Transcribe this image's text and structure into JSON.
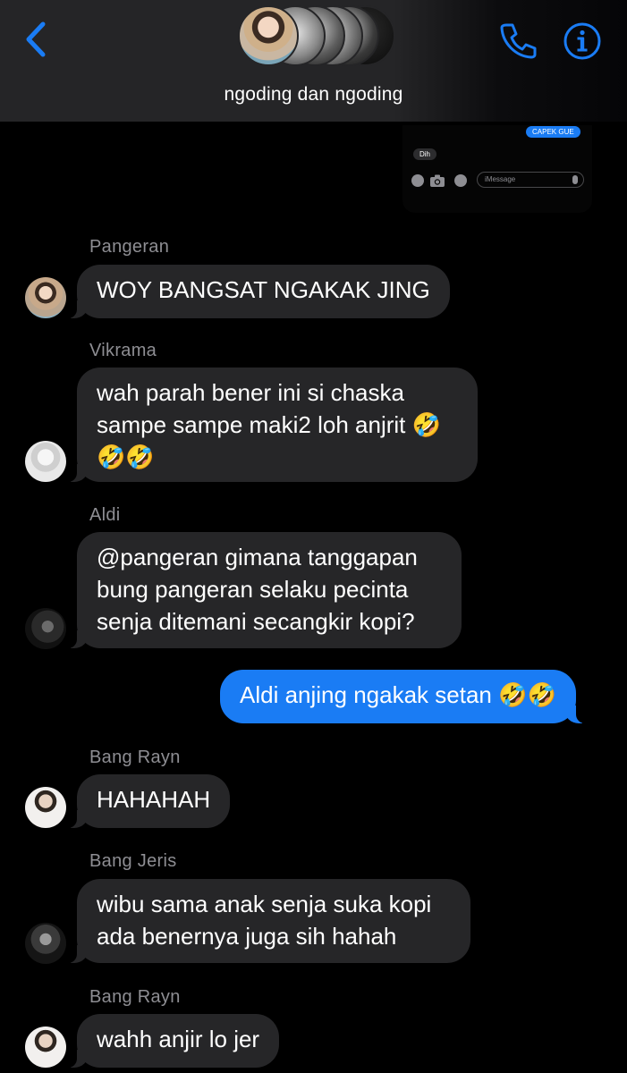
{
  "header": {
    "group_name": "ngoding dan ngoding",
    "back_icon": "chevron-left-icon",
    "call_icon": "phone-icon",
    "info_icon": "info-icon",
    "accent_color": "#1a7cf4"
  },
  "embedded_screenshot": {
    "sent_bubble": "CAPEK GUE",
    "received_bubble": "Dih",
    "input_placeholder": "iMessage"
  },
  "messages": [
    {
      "sender": "Pangeran",
      "text": "WOY BANGSAT NGAKAK JING"
    },
    {
      "sender": "Vikrama",
      "text": "wah parah bener ini si chaska\nsampe sampe maki2 loh anjrit 🤣\n🤣🤣"
    },
    {
      "sender": "Aldi",
      "text": "@pangeran gimana tanggapan\nbung pangeran selaku pecinta\nsenja ditemani secangkir kopi?"
    },
    {
      "sender": "",
      "text": "Aldi anjing ngakak setan 🤣🤣",
      "outgoing": true
    },
    {
      "sender": "Bang Rayn",
      "text": "HAHAHAH"
    },
    {
      "sender": "Bang Jeris",
      "text": "wibu sama anak senja suka kopi\nada benernya juga sih hahah"
    },
    {
      "sender": "Bang Rayn",
      "text": "wahh anjir lo jer"
    }
  ]
}
